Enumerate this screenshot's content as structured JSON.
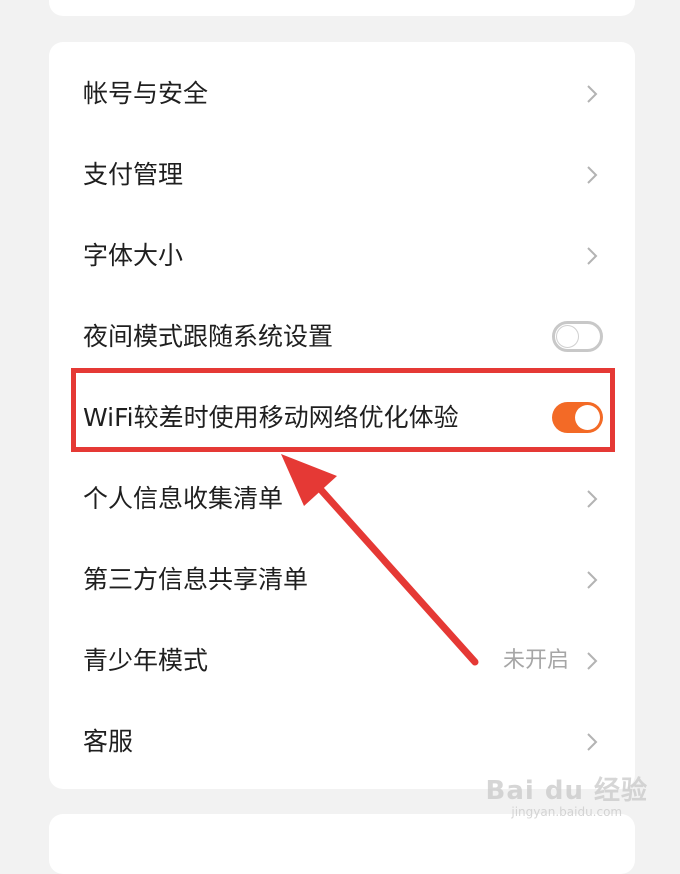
{
  "settings": {
    "items": [
      {
        "label": "帐号与安全",
        "control": "chevron"
      },
      {
        "label": "支付管理",
        "control": "chevron"
      },
      {
        "label": "字体大小",
        "control": "chevron"
      },
      {
        "label": "夜间模式跟随系统设置",
        "control": "toggle",
        "toggle_state": "off"
      },
      {
        "label": "WiFi较差时使用移动网络优化体验",
        "control": "toggle",
        "toggle_state": "on"
      },
      {
        "label": "个人信息收集清单",
        "control": "chevron"
      },
      {
        "label": "第三方信息共享清单",
        "control": "chevron"
      },
      {
        "label": "青少年模式",
        "control": "chevron",
        "value": "未开启"
      },
      {
        "label": "客服",
        "control": "chevron"
      }
    ]
  },
  "colors": {
    "page_background": "#f2f2f2",
    "card_background": "#ffffff",
    "toggle_on": "#f36a26",
    "annotation_red": "#e53935",
    "chevron": "#b3b3b3"
  },
  "icons": {
    "chevron": "chevron-right-icon",
    "annotation_arrow": "arrow-icon"
  },
  "watermark": {
    "main": "Bai du 经验",
    "sub": "jingyan.baidu.com"
  }
}
